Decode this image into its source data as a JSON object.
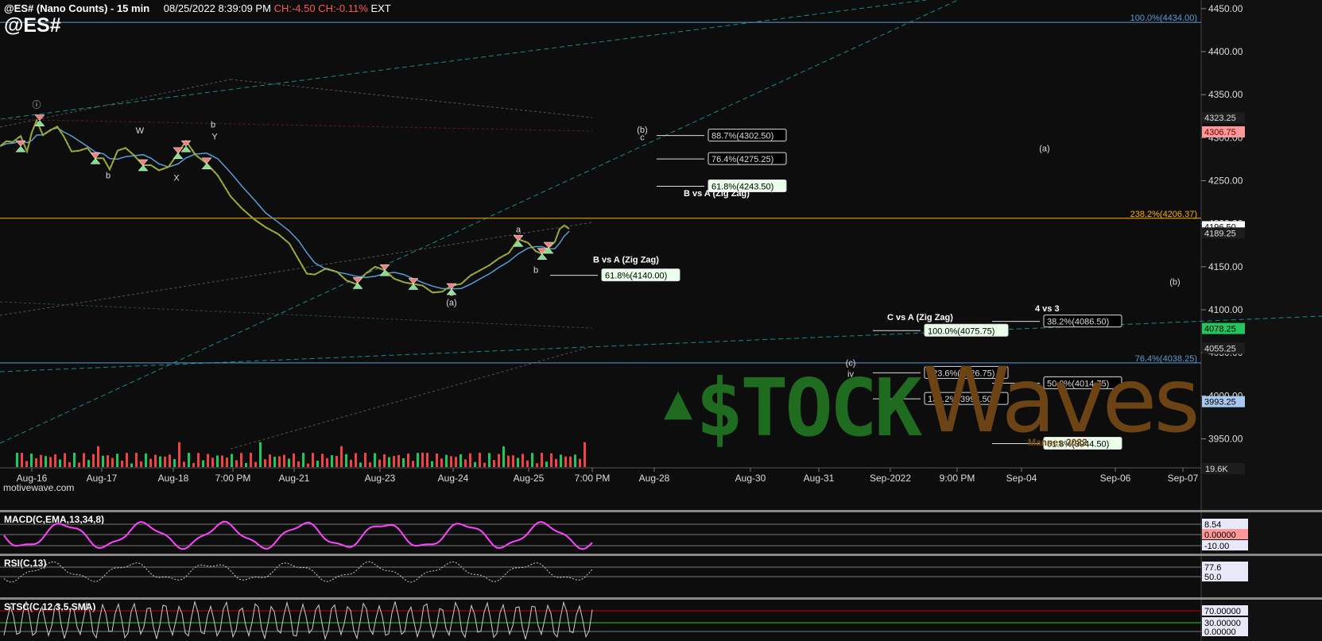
{
  "header": {
    "symbol": "@ES# (Nano Counts) - 15 min",
    "datetime": "08/25/2022 8:39:09 PM",
    "change": "CH:-4.50",
    "change_pct": "CH:-0.11%",
    "session": "EXT",
    "big_symbol": "@ES#"
  },
  "watermark": "motivewave.com",
  "logo": {
    "stock": "$TOCK",
    "waves": "Waves",
    "copyright": "Mannes 2022"
  },
  "colors": {
    "up": "#22c55e",
    "down": "#ef4444",
    "ma": "#5b9bd5",
    "fib_blue": "#5b9bd5",
    "fib_orange": "#ffb000",
    "macd": "#ff44ff",
    "background": "#0d0d0d"
  },
  "chart_data": {
    "type": "line",
    "title": "@ES# (Nano Counts) - 15 min",
    "xlabel": "",
    "ylabel": "",
    "ylim": [
      3920,
      4460
    ],
    "x_ticks": [
      "Aug-16",
      "Aug-17",
      "Aug-18",
      "7:00 PM",
      "Aug-21",
      "Aug-23",
      "Aug-24",
      "Aug-25",
      "7:00 PM",
      "Aug-28",
      "Aug-30",
      "Aug-31",
      "Sep-2022",
      "9:00 PM",
      "Sep-04",
      "Sep-06",
      "Sep-07"
    ],
    "y_ticks": [
      "4450.00",
      "4400.00",
      "4350.00",
      "4300.00",
      "4250.00",
      "4200.00",
      "4150.00",
      "4100.00",
      "4050.00",
      "4000.00",
      "3950.00"
    ],
    "y_tick_values": [
      4450,
      4400,
      4350,
      4300,
      4250,
      4200,
      4150,
      4100,
      4050,
      4000,
      3950
    ],
    "series": [
      {
        "points": [
          [
            0,
            4290
          ],
          [
            4,
            4296
          ],
          [
            8,
            4295
          ],
          [
            13,
            4302
          ],
          [
            17,
            4284
          ],
          [
            20,
            4306
          ],
          [
            23,
            4320
          ],
          [
            27,
            4303
          ],
          [
            32,
            4309
          ],
          [
            36,
            4313
          ],
          [
            40,
            4302
          ],
          [
            45,
            4284
          ],
          [
            50,
            4285
          ],
          [
            55,
            4288
          ],
          [
            60,
            4276
          ],
          [
            65,
            4276
          ],
          [
            69,
            4263
          ],
          [
            74,
            4285
          ],
          [
            79,
            4288
          ],
          [
            84,
            4280
          ],
          [
            90,
            4268
          ],
          [
            95,
            4268
          ],
          [
            100,
            4262
          ],
          [
            106,
            4266
          ],
          [
            112,
            4282
          ],
          [
            117,
            4296
          ],
          [
            123,
            4280
          ],
          [
            130,
            4270
          ],
          [
            137,
            4256
          ],
          [
            145,
            4232
          ],
          [
            152,
            4218
          ],
          [
            160,
            4205
          ],
          [
            167,
            4196
          ],
          [
            175,
            4188
          ],
          [
            182,
            4177
          ],
          [
            188,
            4158
          ],
          [
            193,
            4142
          ],
          [
            198,
            4141
          ],
          [
            205,
            4148
          ],
          [
            212,
            4144
          ],
          [
            218,
            4134
          ],
          [
            224,
            4130
          ],
          [
            230,
            4142
          ],
          [
            236,
            4150
          ],
          [
            242,
            4146
          ],
          [
            248,
            4136
          ],
          [
            254,
            4132
          ],
          [
            260,
            4130
          ],
          [
            266,
            4128
          ],
          [
            272,
            4120
          ],
          [
            278,
            4121
          ],
          [
            284,
            4128
          ],
          [
            290,
            4130
          ],
          [
            296,
            4140
          ],
          [
            302,
            4146
          ],
          [
            308,
            4152
          ],
          [
            314,
            4160
          ],
          [
            320,
            4166
          ],
          [
            326,
            4182
          ],
          [
            332,
            4178
          ],
          [
            337,
            4168
          ],
          [
            341,
            4165
          ],
          [
            345,
            4172
          ],
          [
            349,
            4179
          ],
          [
            352,
            4194
          ],
          [
            355,
            4198
          ],
          [
            358,
            4194
          ]
        ]
      }
    ],
    "annotations": {
      "wave_labels": [
        {
          "t": "ⓘ",
          "x": 23,
          "p": 4335
        },
        {
          "t": "b",
          "x": 68,
          "p": 4253
        },
        {
          "t": "W",
          "x": 88,
          "p": 4305
        },
        {
          "t": "X",
          "x": 111,
          "p": 4250
        },
        {
          "t": "b",
          "x": 134,
          "p": 4312
        },
        {
          "t": "Y",
          "x": 135,
          "p": 4298
        },
        {
          "t": "(b)",
          "x": 404,
          "p": 4306
        },
        {
          "t": "c",
          "x": 404,
          "p": 4297
        },
        {
          "t": "a",
          "x": 326,
          "p": 4190
        },
        {
          "t": "b",
          "x": 337,
          "p": 4143
        },
        {
          "t": "c",
          "x": 284,
          "p": 4116
        },
        {
          "t": "(a)",
          "x": 284,
          "p": 4105
        },
        {
          "t": "(c)",
          "x": 535,
          "p": 4035
        },
        {
          "t": "iv",
          "x": 535,
          "p": 4022
        },
        {
          "t": "(a)",
          "x": 657,
          "p": 4284
        },
        {
          "t": "(b)",
          "x": 739,
          "p": 4129
        }
      ],
      "fib_boxes": [
        {
          "t": "88.7%(4302.50)",
          "x": 443,
          "p": 4302.5,
          "hi": false
        },
        {
          "t": "76.4%(4275.25)",
          "x": 443,
          "p": 4275.25,
          "hi": false
        },
        {
          "t": "61.8%(4243.50)",
          "x": 443,
          "p": 4243.5,
          "hi": true
        },
        {
          "t": "61.8%(4140.00)",
          "x": 376,
          "p": 4140.0,
          "hi": true
        },
        {
          "t": "100.0%(4075.75)",
          "x": 579,
          "p": 4075.75,
          "hi": true
        },
        {
          "t": "123.6%(4026.75)",
          "x": 579,
          "p": 4026.75,
          "hi": false
        },
        {
          "t": "138.2%(3996.50)",
          "x": 579,
          "p": 3996.5,
          "hi": false
        },
        {
          "t": "38.2%(4086.50)",
          "x": 654,
          "p": 4086.5,
          "hi": false
        },
        {
          "t": "50.0%(4014.75)",
          "x": 654,
          "p": 4014.75,
          "hi": false
        },
        {
          "t": "61.8%(3944.50)",
          "x": 654,
          "p": 3944.5,
          "hi": true
        }
      ],
      "fib_titles": [
        {
          "t": "B vs A (Zig Zag)",
          "x": 430,
          "p": 4232
        },
        {
          "t": "B vs A (Zig Zag)",
          "x": 373,
          "p": 4155
        },
        {
          "t": "C vs A (Zig Zag)",
          "x": 558,
          "p": 4088
        },
        {
          "t": "4 vs 3",
          "x": 651,
          "p": 4098
        }
      ],
      "hlines": [
        {
          "t": "100.0%(4434.00)",
          "p": 4434.0,
          "color": "#5b9bd5"
        },
        {
          "t": "238.2%(4206.37)",
          "p": 4206.37,
          "color": "#ffb000"
        },
        {
          "t": "76.4%(4038.25)",
          "p": 4038.25,
          "color": "#5b9bd5"
        }
      ],
      "price_tags": [
        {
          "t": "4323.25",
          "p": 4323.25,
          "bg": "#1d1d1d",
          "fg": "#ddd"
        },
        {
          "t": "4306.75",
          "p": 4306.75,
          "bg": "#ff9999",
          "fg": "#600"
        },
        {
          "t": "4196.50",
          "p": 4196.5,
          "bg": "#ffffff",
          "fg": "#000"
        },
        {
          "t": "4189.25",
          "p": 4189.25,
          "bg": "#1d1d1d",
          "fg": "#ddd"
        },
        {
          "t": "4078.25",
          "p": 4078.25,
          "bg": "#22c55e",
          "fg": "#000"
        },
        {
          "t": "4055.25",
          "p": 4055.25,
          "bg": "#1d1d1d",
          "fg": "#ddd"
        },
        {
          "t": "3993.25",
          "p": 3993.25,
          "bg": "#a8c8f0",
          "fg": "#000"
        }
      ]
    },
    "volume_tag": "19.6K",
    "indicators": [
      {
        "name": "MACD(C,EMA,13,34,8)",
        "ticks": [
          "8.54",
          "0.00000",
          "-10.00"
        ]
      },
      {
        "name": "RSI(C,13)",
        "ticks": [
          "77.6",
          "50.0"
        ]
      },
      {
        "name": "STSC(C,12,3,5,SMA)",
        "ticks": [
          "70.00000",
          "30.00000",
          "0.00000"
        ]
      }
    ]
  }
}
